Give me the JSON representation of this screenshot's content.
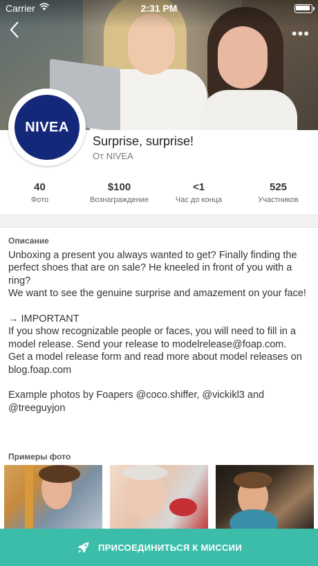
{
  "status_bar": {
    "carrier": "Carrier",
    "time": "2:31 PM"
  },
  "mission": {
    "title": "Surprise, surprise!",
    "byline": "От NIVEA",
    "brand_logo_text": "NIVEA"
  },
  "stats": [
    {
      "value": "40",
      "label": "Фото"
    },
    {
      "value": "$100",
      "label": "Вознаграждение"
    },
    {
      "value": "<1",
      "label": "Час до конца"
    },
    {
      "value": "525",
      "label": "Участников"
    }
  ],
  "description": {
    "heading": "Описание",
    "text": "Unboxing a present you always wanted to get? Finally finding the perfect shoes that are on sale? He kneeled in front of you with a ring?\nWe want to see the genuine surprise and amazement on your face!\n\n→ IMPORTANT\nIf you show recognizable people or faces, you will need to fill in a  model release. Send your release to modelrelease@foap.com.\nGet a model release form and read more about model releases on blog.foap.com\n\nExample photos by Foapers @coco.shiffer, @vickikl3 and @treeguyjon"
  },
  "examples": {
    "heading": "Примеры фото"
  },
  "cta": {
    "label": "ПРИСОЕДИНИТЬСЯ К МИССИИ"
  },
  "colors": {
    "accent": "#3cbda9",
    "brand": "#14287a"
  },
  "icons": [
    "wifi-icon",
    "battery-icon",
    "back-chevron-icon",
    "more-dots-icon",
    "rocket-icon"
  ]
}
